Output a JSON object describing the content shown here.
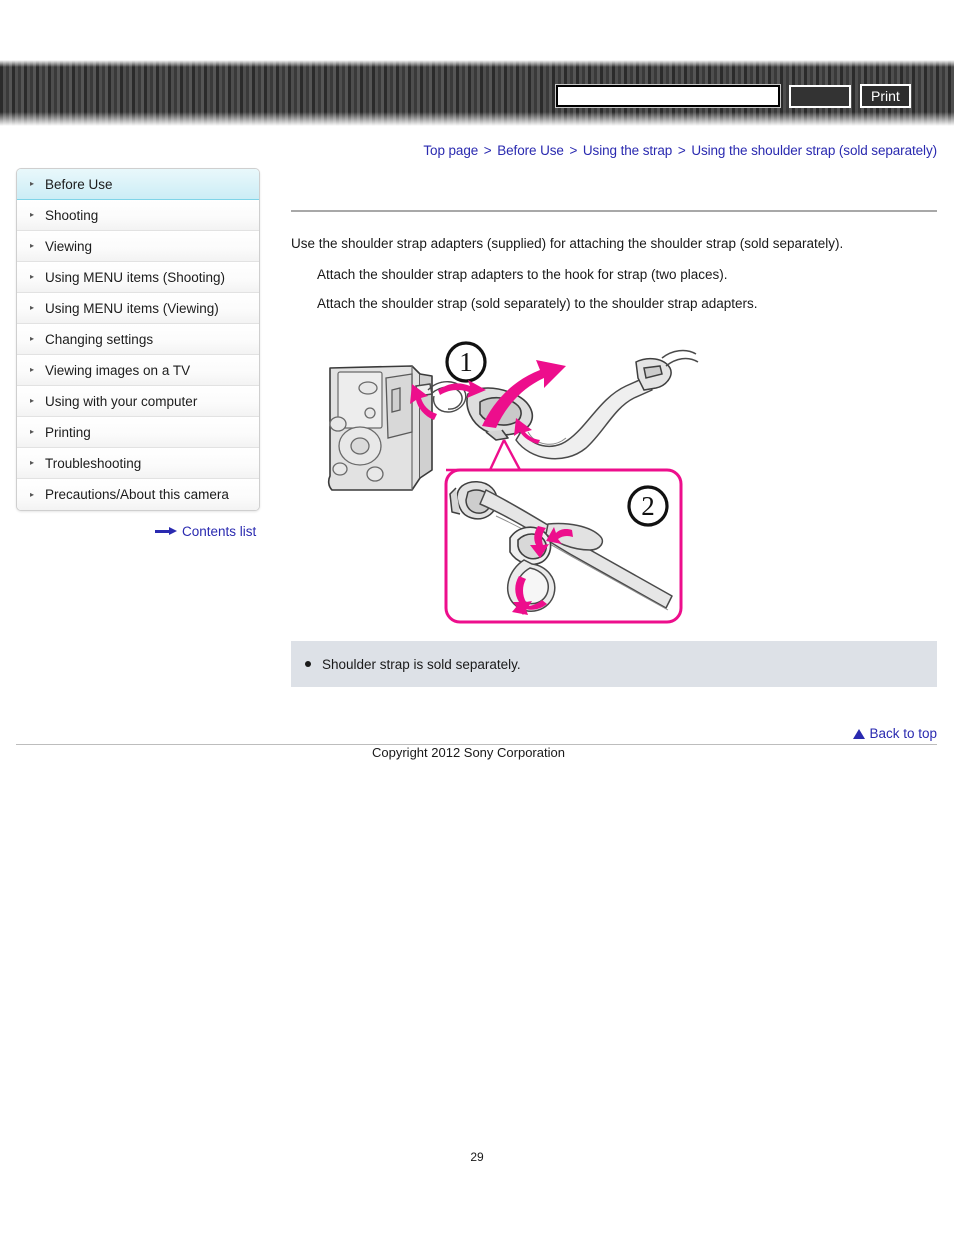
{
  "header": {
    "search_placeholder": "",
    "search_value": "",
    "search_button_label": "",
    "print_button_label": "Print"
  },
  "breadcrumb": {
    "separator": ">",
    "items": [
      {
        "label": "Top page"
      },
      {
        "label": "Before Use"
      },
      {
        "label": "Using the strap"
      },
      {
        "label": "Using the shoulder strap (sold separately)"
      }
    ]
  },
  "sidebar": {
    "arrow_glyph": "▸",
    "items": [
      {
        "label": "Before Use",
        "active": true
      },
      {
        "label": "Shooting",
        "active": false
      },
      {
        "label": "Viewing",
        "active": false
      },
      {
        "label": "Using MENU items (Shooting)",
        "active": false
      },
      {
        "label": "Using MENU items (Viewing)",
        "active": false
      },
      {
        "label": "Changing settings",
        "active": false
      },
      {
        "label": "Viewing images on a TV",
        "active": false
      },
      {
        "label": "Using with your computer",
        "active": false
      },
      {
        "label": "Printing",
        "active": false
      },
      {
        "label": "Troubleshooting",
        "active": false
      },
      {
        "label": "Precautions/About this camera",
        "active": false
      }
    ],
    "contents_list_label": "Contents list"
  },
  "main": {
    "lead": "Use the shoulder strap adapters (supplied) for attaching the shoulder strap (sold separately).",
    "steps": [
      "Attach the shoulder strap adapters to the hook for strap (two places).",
      "Attach the shoulder strap (sold separately) to the shoulder strap adapters."
    ]
  },
  "illustration": {
    "step1_number": "1",
    "step2_number": "2",
    "accent_color": "#ED0E8C",
    "line_color": "#333333",
    "fill_color": "#DCDCDC",
    "alt": "Camera body with shoulder strap adapter attached to the strap hook, and a detail callout showing the strap threaded through the adapter buckle"
  },
  "note": {
    "text": "Shoulder strap is sold separately."
  },
  "footer": {
    "back_to_top_label": "Back to top",
    "copyright": "Copyright 2012 Sony Corporation",
    "page_number": "29"
  }
}
